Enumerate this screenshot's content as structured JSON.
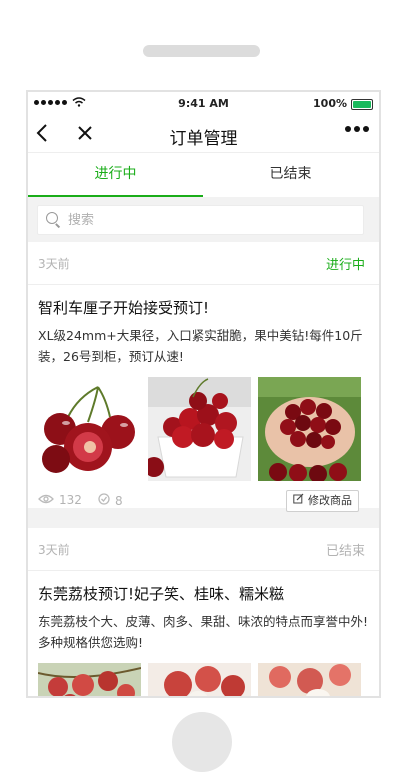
{
  "status_bar": {
    "time": "9:41 AM",
    "battery": "100%"
  },
  "nav": {
    "title": "订单管理"
  },
  "tabs": [
    {
      "label": "进行中",
      "active": true
    },
    {
      "label": "已结束",
      "active": false
    }
  ],
  "search": {
    "placeholder": "搜索"
  },
  "colors": {
    "accent": "#1aad19",
    "ended": "#b3b3b3"
  },
  "orders": [
    {
      "time_ago": "3天前",
      "status": "进行中",
      "title": "智利车厘子开始接受预订!",
      "description": "XL级24mm+大果径，入口紧实甜脆，果中美钻!每件10斤装，26号到柜，预订从速!",
      "images": [
        "cherries-halved",
        "cherries-bowl",
        "cherries-hands"
      ],
      "views": "132",
      "likes": "8",
      "edit_label": "修改商品"
    },
    {
      "time_ago": "3天前",
      "status": "已结束",
      "title": "东莞荔枝预订!妃子笑、桂味、糯米糍",
      "description": "东莞荔枝个大、皮薄、肉多、果甜、味浓的特点而享誉中外!多种规格供您选购!",
      "images": [
        "lychee-branch",
        "lychee-peeled",
        "lychee-pile"
      ]
    }
  ]
}
